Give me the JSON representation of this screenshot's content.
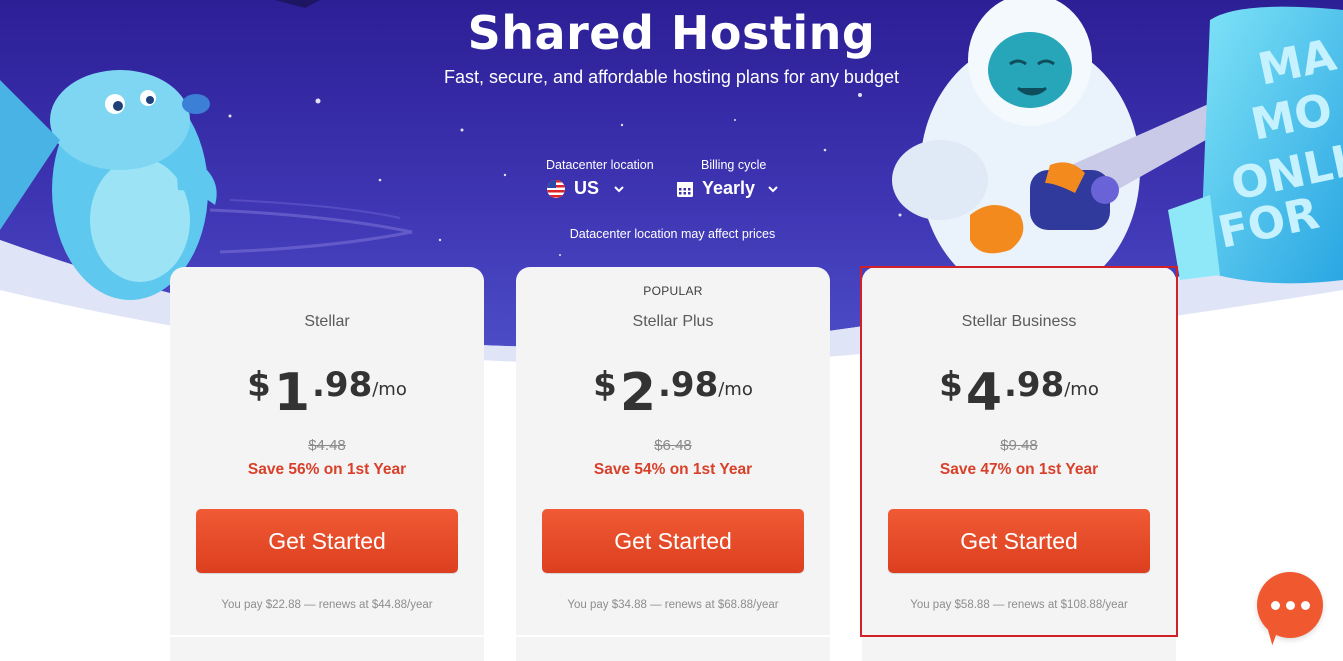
{
  "hero": {
    "title": "Shared Hosting",
    "subtitle": "Fast, secure, and affordable hosting plans for any budget",
    "datacenter": {
      "label": "Datacenter location",
      "value": "US",
      "icon": "us-flag-icon"
    },
    "billing": {
      "label": "Billing cycle",
      "value": "Yearly",
      "icon": "calendar-icon"
    },
    "note": "Datacenter location may affect prices",
    "sign_text": "MAKE MORE ONLINE FOR L"
  },
  "plans": [
    {
      "badge": "",
      "name": "Stellar",
      "currency": "$",
      "price_whole": "1",
      "price_cents": ".98",
      "period": "/mo",
      "old_price": "$4.48",
      "save": "Save 56% on 1st Year",
      "cta": "Get Started",
      "renew": "You pay $22.88 — renews at $44.88/year"
    },
    {
      "badge": "POPULAR",
      "name": "Stellar Plus",
      "currency": "$",
      "price_whole": "2",
      "price_cents": ".98",
      "period": "/mo",
      "old_price": "$6.48",
      "save": "Save 54% on 1st Year",
      "cta": "Get Started",
      "renew": "You pay $34.88 — renews at $68.88/year"
    },
    {
      "badge": "",
      "name": "Stellar Business",
      "currency": "$",
      "price_whole": "4",
      "price_cents": ".98",
      "period": "/mo",
      "old_price": "$9.48",
      "save": "Save 47% on 1st Year",
      "cta": "Get Started",
      "renew": "You pay $58.88 — renews at $108.88/year"
    }
  ],
  "chat": {
    "icon": "chat-bubble-icon"
  },
  "colors": {
    "hero_bg": "#3a2fa8",
    "accent": "#e84c2b",
    "save_text": "#d8402a",
    "highlight_border": "#d0202a"
  }
}
